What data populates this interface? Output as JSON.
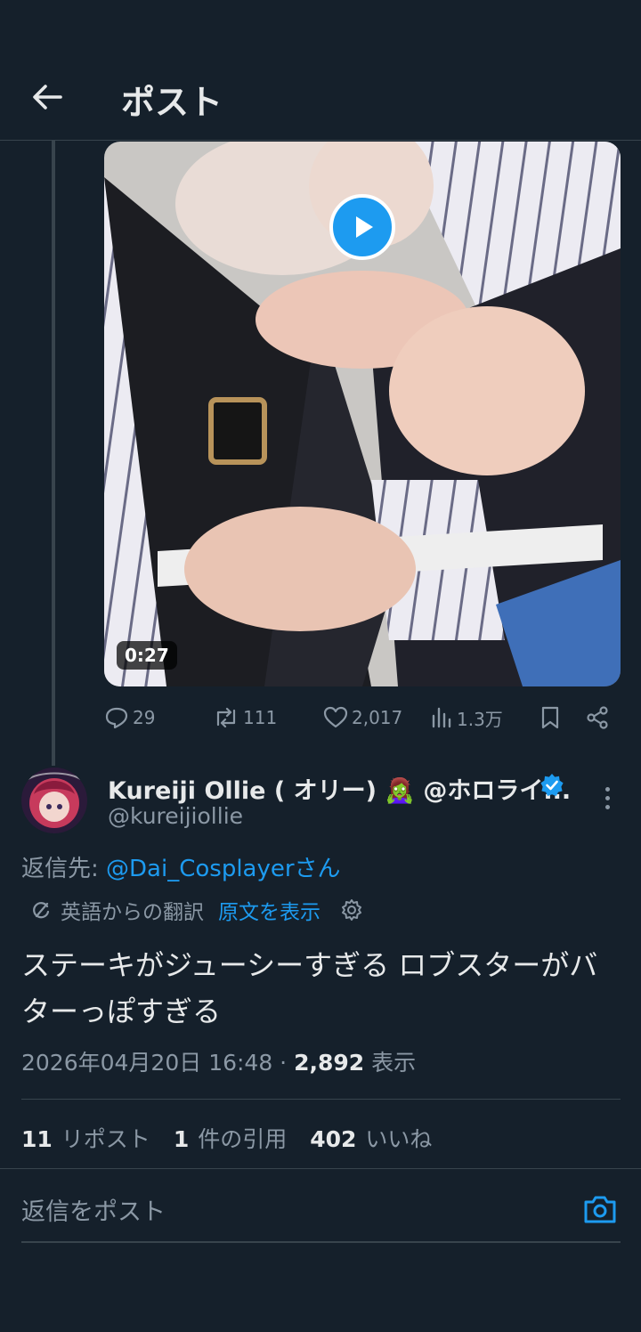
{
  "header": {
    "title": "ポスト",
    "back_icon": "arrow-left-icon"
  },
  "media": {
    "duration": "0:27",
    "play_icon": "play-icon"
  },
  "actions": {
    "replies": "29",
    "reposts": "111",
    "likes": "2,017",
    "views": "1.3万",
    "icons": [
      "reply-icon",
      "repost-icon",
      "like-icon",
      "views-icon",
      "bookmark-icon",
      "share-icon"
    ]
  },
  "author": {
    "name": "Kureiji Ollie ( オリー) 🧟‍♀️ @ホロライ...",
    "handle": "@kureijiollie",
    "verified": true
  },
  "reply_to": {
    "label": "返信先: ",
    "mention": "@Dai_Cosplayerさん"
  },
  "translation": {
    "label": "英語からの翻訳",
    "show_original": "原文を表示"
  },
  "post": {
    "text": "ステーキがジューシーすぎる ロブスターがバターっぽすぎる",
    "timestamp": "2026年04月20日 16:48 · ",
    "views_count": "2,892",
    "views_label": " 表示"
  },
  "stats": {
    "reposts_count": "11",
    "reposts_label": "リポスト",
    "quotes_count": "1",
    "quotes_label": "件の引用",
    "likes_count": "402",
    "likes_label": "いいね"
  },
  "reply_box": {
    "placeholder": "返信をポスト"
  },
  "colors": {
    "background": "#15202b",
    "accent": "#1d9bf0",
    "muted": "#8b98a5",
    "border": "#38444d"
  }
}
